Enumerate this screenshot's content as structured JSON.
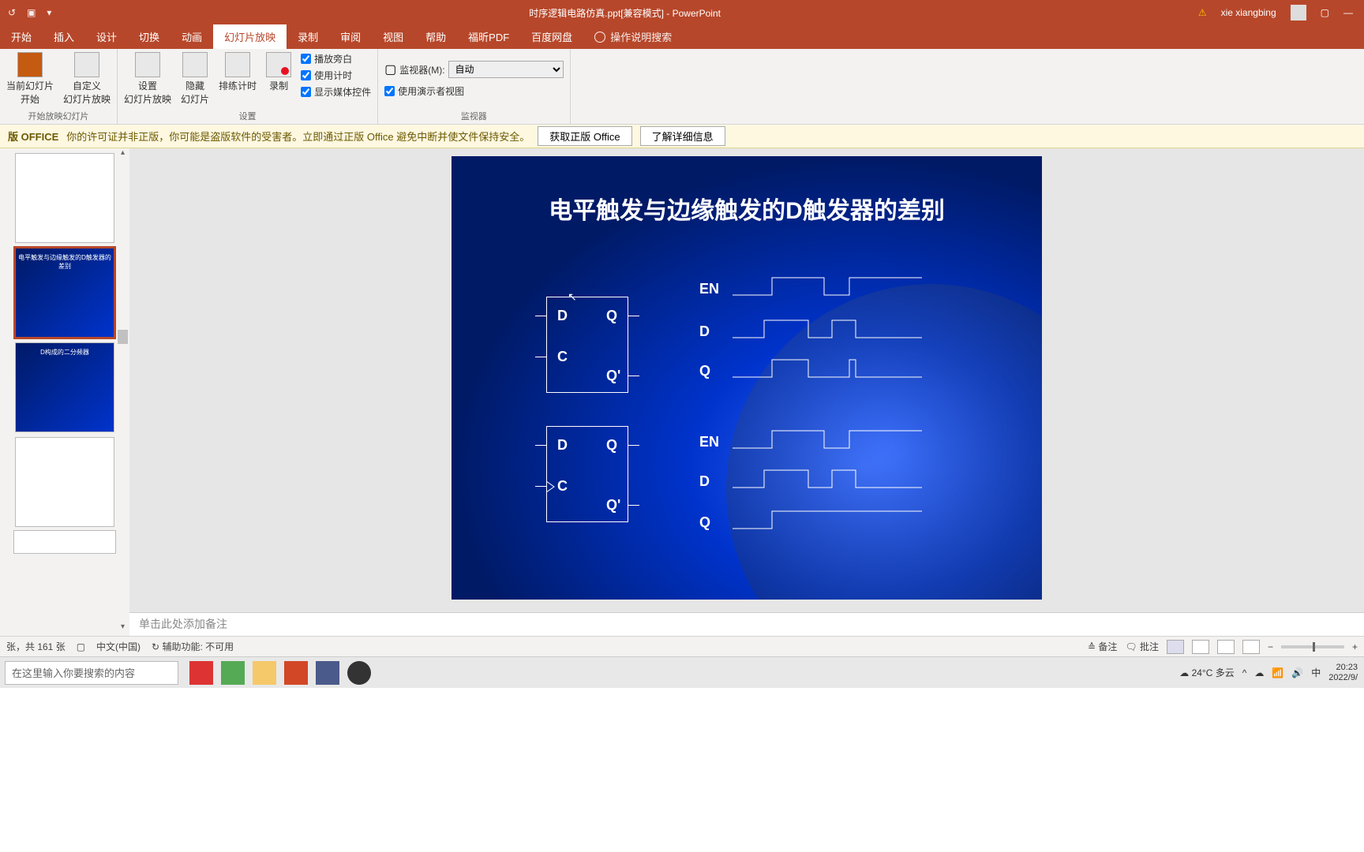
{
  "title": {
    "document": "时序逻辑电路仿真.ppt[兼容模式] - PowerPoint",
    "user": "xie xiangbing"
  },
  "tabs": {
    "start": "开始",
    "insert": "插入",
    "design": "设计",
    "transition": "切换",
    "animation": "动画",
    "slideshow": "幻灯片放映",
    "record": "录制",
    "review": "审阅",
    "view": "视图",
    "help": "帮助",
    "foxit": "福昕PDF",
    "baidu": "百度网盘",
    "tellme": "操作说明搜索"
  },
  "ribbon": {
    "from_current": "当前幻灯片\n开始",
    "custom": "自定义\n幻灯片放映",
    "start_group": "开始放映幻灯片",
    "setup": "设置\n幻灯片放映",
    "hide": "隐藏\n幻灯片",
    "rehearse": "排练计时",
    "record": "录制",
    "narration": "播放旁白",
    "timing": "使用计时",
    "media": "显示媒体控件",
    "setup_group": "设置",
    "monitor_label": "监视器(M):",
    "monitor_value": "自动",
    "presenter": "使用演示者视图",
    "monitor_group": "监视器"
  },
  "warn": {
    "lead": "版 OFFICE",
    "text": "你的许可证并非正版，你可能是盗版软件的受害者。立即通过正版 Office 避免中断并使文件保持安全。",
    "btn1": "获取正版 Office",
    "btn2": "了解详细信息"
  },
  "slide": {
    "title": "电平触发与边缘触发的D触发器的差别",
    "labels": {
      "D": "D",
      "C": "C",
      "Q": "Q",
      "Qn": "Q'",
      "EN": "EN"
    }
  },
  "thumbs": {
    "t2_text": "电平触发与边缘触发的D触发器的差别",
    "t3_text": "D构成的二分频器"
  },
  "notes": {
    "placeholder": "单击此处添加备注"
  },
  "status": {
    "slide_info": "张，共 161 张",
    "lang": "中文(中国)",
    "access": "辅助功能: 不可用",
    "notes": "备注",
    "comments": "批注"
  },
  "taskbar": {
    "search": "在这里输入你要搜索的内容",
    "weather": "24°C 多云",
    "ime": "中",
    "time": "20:23",
    "date": "2022/9/"
  }
}
